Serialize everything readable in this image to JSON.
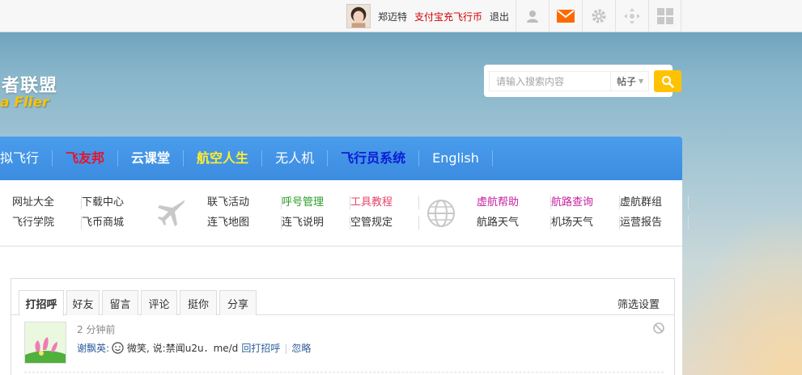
{
  "topbar": {
    "username": "郑迈特",
    "recharge_link": "支付宝充飞行币",
    "logout": "退出",
    "icons": [
      "user-icon",
      "mail-icon",
      "gear-icon",
      "move-icon",
      "grid-icon"
    ],
    "accent_mail": "#ff6a00"
  },
  "logo": {
    "cn": "者联盟",
    "en": "a Flier"
  },
  "search": {
    "placeholder": "请输入搜索内容",
    "type": "帖子",
    "button_color": "#ffc200"
  },
  "mainnav": {
    "items": [
      {
        "label": "拟飞行"
      },
      {
        "label": "飞友邦"
      },
      {
        "label": "云课堂"
      },
      {
        "label": "航空人生"
      },
      {
        "label": "无人机"
      },
      {
        "label": "飞行员系统"
      },
      {
        "label": "English"
      }
    ],
    "background": "#3f90e4"
  },
  "subnav": {
    "group1": [
      "网址大全",
      "飞行学院",
      "下载中心",
      "飞币商城"
    ],
    "group2": [
      "联飞活动",
      "连飞地图",
      "呼号管理",
      "连飞说明",
      "工具教程",
      "空管规定"
    ],
    "group3": [
      "虚航帮助",
      "航路天气",
      "航路查询",
      "机场天气",
      "虚航群组",
      "运营报告"
    ]
  },
  "feed": {
    "tabs": [
      "打招呼",
      "好友",
      "留言",
      "评论",
      "挺你",
      "分享"
    ],
    "active_tab": "打招呼",
    "filter": "筛选设置",
    "entry": {
      "time": "2 分钟前",
      "name": "谢飘英:",
      "message": "微笑, 说:禁闻u2u．me/d",
      "action": "回打招呼",
      "ignore": "忽略"
    }
  }
}
